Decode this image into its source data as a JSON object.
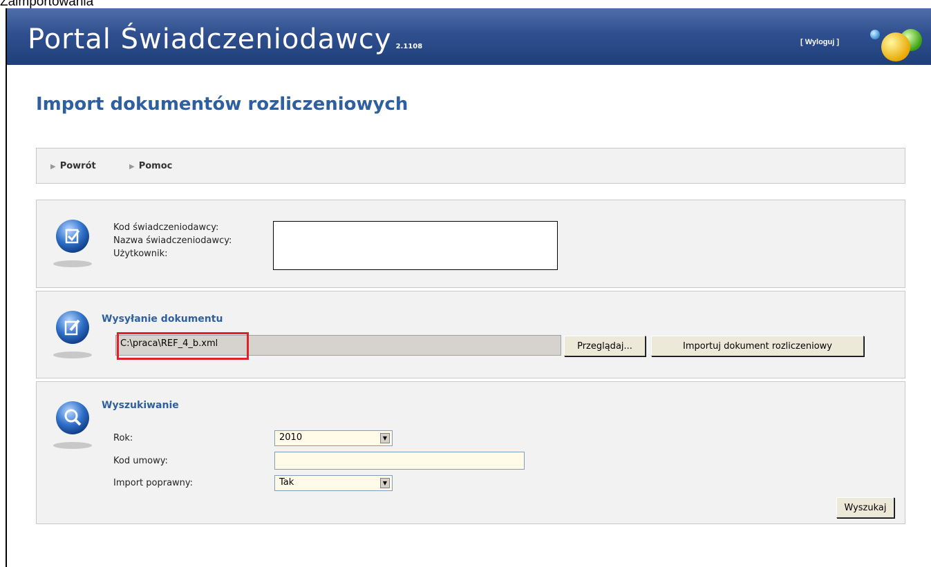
{
  "caption": "Zaimportowania",
  "header": {
    "title": "Portal Świadczeniodawcy",
    "version": "2.1108",
    "logout_label": "[ Wyloguj ]"
  },
  "page_title": "Import dokumentów rozliczeniowych",
  "toolbar": {
    "back_label": "Powrót",
    "help_label": "Pomoc"
  },
  "provider_info": {
    "code_label": "Kod świadczeniodawcy:",
    "name_label": "Nazwa świadczeniodawcy:",
    "user_label": "Użytkownik:"
  },
  "upload": {
    "title": "Wysyłanie dokumentu",
    "file_path": "C:\\praca\\REF_4_b.xml",
    "browse_label": "Przeglądaj...",
    "import_label": "Importuj dokument rozliczeniowy"
  },
  "search": {
    "title": "Wyszukiwanie",
    "year_label": "Rok:",
    "year_value": "2010",
    "contract_label": "Kod umowy:",
    "contract_value": "",
    "import_ok_label": "Import poprawny:",
    "import_ok_value": "Tak",
    "search_label": "Wyszukaj"
  },
  "colors": {
    "header_bg": "#2f4f8f",
    "title_blue": "#2f5f9f",
    "highlight_red": "#e0202a",
    "input_bg": "#fffbe8"
  }
}
